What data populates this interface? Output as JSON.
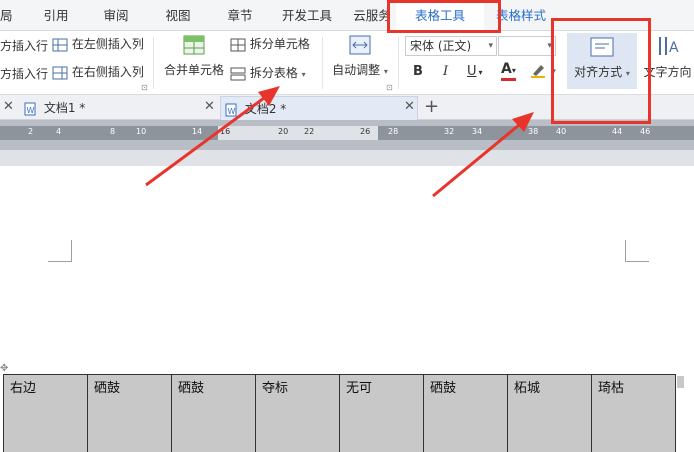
{
  "tabs": [
    "局",
    "引用",
    "审阅",
    "视图",
    "章节",
    "开发工具",
    "云服务",
    "表格工具",
    "表格样式"
  ],
  "ribbon": {
    "insert_row_above": "方插入行",
    "insert_row_below": "方插入行",
    "insert_col_left": "在左侧插入列",
    "insert_col_right": "在右侧插入列",
    "merge_cells": "合并单元格",
    "split_cells": "拆分单元格",
    "split_table": "拆分表格",
    "auto_adjust": "自动调整",
    "font_name": "宋体 (正文)",
    "font_size": "",
    "bold": "B",
    "italic": "I",
    "underline": "U",
    "font_color": "A",
    "align": "对齐方式",
    "text_direction": "文字方向"
  },
  "doc_tabs": [
    {
      "label": "文档1 *"
    },
    {
      "label": "文档2 *"
    }
  ],
  "ruler": [
    "2",
    "4",
    "8",
    "10",
    "14",
    "16",
    "20",
    "22",
    "26",
    "28",
    "32",
    "34",
    "38",
    "40",
    "44",
    "46"
  ],
  "table_row": [
    "右边",
    "硒鼓",
    "硒鼓",
    "夺标",
    "无可",
    "硒鼓",
    "柘城",
    "琦枯"
  ],
  "colors": {
    "accent": "#2a6fc9",
    "highlight": "#e8352c",
    "cell_fill": "#c8c8c8"
  }
}
